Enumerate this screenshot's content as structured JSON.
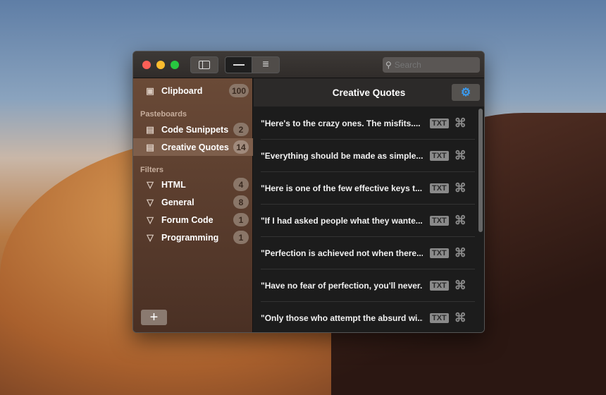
{
  "toolbar": {
    "search_placeholder": "Search"
  },
  "sidebar": {
    "clipboard": {
      "label": "Clipboard",
      "count": "100"
    },
    "pasteboards_header": "Pasteboards",
    "pasteboards": [
      {
        "label": "Code Sunippets",
        "count": "2"
      },
      {
        "label": "Creative Quotes",
        "count": "14",
        "selected": true
      }
    ],
    "filters_header": "Filters",
    "filters": [
      {
        "label": "HTML",
        "count": "4"
      },
      {
        "label": "General",
        "count": "8"
      },
      {
        "label": "Forum Code",
        "count": "1"
      },
      {
        "label": "Programming",
        "count": "1"
      }
    ],
    "add_label": "+"
  },
  "main": {
    "title": "Creative Quotes",
    "items": [
      {
        "text": "\"Here's to the crazy ones. The misfits....",
        "type": "TXT"
      },
      {
        "text": "\"Everything should be made as simple...",
        "type": "TXT"
      },
      {
        "text": "\"Here is one of the few effective keys t...",
        "type": "TXT"
      },
      {
        "text": "\"If I had asked people what they wante...",
        "type": "TXT"
      },
      {
        "text": "\"Perfection is achieved not when there...",
        "type": "TXT"
      },
      {
        "text": "\"Have no fear of perfection, you'll never...",
        "type": "TXT"
      },
      {
        "text": "\"Only those who attempt the absurd wi...",
        "type": "TXT"
      }
    ]
  },
  "colors": {
    "accent": "#3a9aef",
    "sidebar": "#5a3c2d"
  }
}
